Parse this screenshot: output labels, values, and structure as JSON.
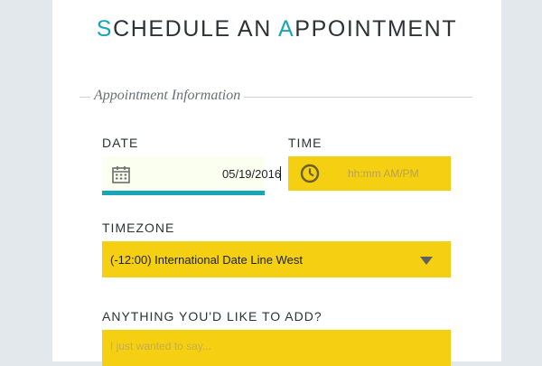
{
  "title": {
    "first_letter": "S",
    "first_rest": "CHEDULE AN ",
    "second_letter": "A",
    "second_rest": "PPOINTMENT"
  },
  "section": {
    "legend": "Appointment Information"
  },
  "date": {
    "label": "DATE",
    "value": "05/19/2016",
    "icon": "calendar-icon"
  },
  "time": {
    "label": "TIME",
    "placeholder": "hh:mm AM/PM",
    "icon": "clock-icon"
  },
  "timezone": {
    "label": "TIMEZONE",
    "selected": "(-12:00) International Date Line West",
    "icon": "chevron-down-icon"
  },
  "notes": {
    "label": "ANYTHING YOU'D LIKE TO ADD?",
    "placeholder": "I just wanted to say..."
  },
  "colors": {
    "accent": "#17a5b8",
    "field_yellow": "#f4cf12",
    "background": "#e3e8ec"
  }
}
